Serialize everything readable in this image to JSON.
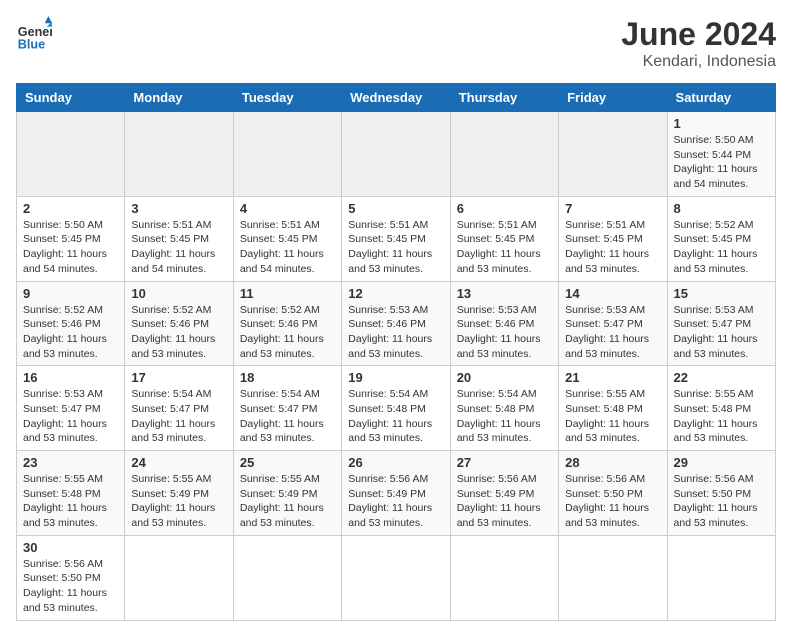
{
  "header": {
    "logo_general": "General",
    "logo_blue": "Blue",
    "title": "June 2024",
    "subtitle": "Kendari, Indonesia"
  },
  "days_of_week": [
    "Sunday",
    "Monday",
    "Tuesday",
    "Wednesday",
    "Thursday",
    "Friday",
    "Saturday"
  ],
  "weeks": [
    [
      {
        "day": "",
        "info": "",
        "empty": true
      },
      {
        "day": "",
        "info": "",
        "empty": true
      },
      {
        "day": "",
        "info": "",
        "empty": true
      },
      {
        "day": "",
        "info": "",
        "empty": true
      },
      {
        "day": "",
        "info": "",
        "empty": true
      },
      {
        "day": "",
        "info": "",
        "empty": true
      },
      {
        "day": "1",
        "info": "Sunrise: 5:50 AM\nSunset: 5:44 PM\nDaylight: 11 hours and 54 minutes."
      }
    ],
    [
      {
        "day": "2",
        "info": "Sunrise: 5:50 AM\nSunset: 5:45 PM\nDaylight: 11 hours and 54 minutes."
      },
      {
        "day": "3",
        "info": "Sunrise: 5:51 AM\nSunset: 5:45 PM\nDaylight: 11 hours and 54 minutes."
      },
      {
        "day": "4",
        "info": "Sunrise: 5:51 AM\nSunset: 5:45 PM\nDaylight: 11 hours and 54 minutes."
      },
      {
        "day": "5",
        "info": "Sunrise: 5:51 AM\nSunset: 5:45 PM\nDaylight: 11 hours and 53 minutes."
      },
      {
        "day": "6",
        "info": "Sunrise: 5:51 AM\nSunset: 5:45 PM\nDaylight: 11 hours and 53 minutes."
      },
      {
        "day": "7",
        "info": "Sunrise: 5:51 AM\nSunset: 5:45 PM\nDaylight: 11 hours and 53 minutes."
      },
      {
        "day": "8",
        "info": "Sunrise: 5:52 AM\nSunset: 5:45 PM\nDaylight: 11 hours and 53 minutes."
      }
    ],
    [
      {
        "day": "9",
        "info": "Sunrise: 5:52 AM\nSunset: 5:46 PM\nDaylight: 11 hours and 53 minutes."
      },
      {
        "day": "10",
        "info": "Sunrise: 5:52 AM\nSunset: 5:46 PM\nDaylight: 11 hours and 53 minutes."
      },
      {
        "day": "11",
        "info": "Sunrise: 5:52 AM\nSunset: 5:46 PM\nDaylight: 11 hours and 53 minutes."
      },
      {
        "day": "12",
        "info": "Sunrise: 5:53 AM\nSunset: 5:46 PM\nDaylight: 11 hours and 53 minutes."
      },
      {
        "day": "13",
        "info": "Sunrise: 5:53 AM\nSunset: 5:46 PM\nDaylight: 11 hours and 53 minutes."
      },
      {
        "day": "14",
        "info": "Sunrise: 5:53 AM\nSunset: 5:47 PM\nDaylight: 11 hours and 53 minutes."
      },
      {
        "day": "15",
        "info": "Sunrise: 5:53 AM\nSunset: 5:47 PM\nDaylight: 11 hours and 53 minutes."
      }
    ],
    [
      {
        "day": "16",
        "info": "Sunrise: 5:53 AM\nSunset: 5:47 PM\nDaylight: 11 hours and 53 minutes."
      },
      {
        "day": "17",
        "info": "Sunrise: 5:54 AM\nSunset: 5:47 PM\nDaylight: 11 hours and 53 minutes."
      },
      {
        "day": "18",
        "info": "Sunrise: 5:54 AM\nSunset: 5:47 PM\nDaylight: 11 hours and 53 minutes."
      },
      {
        "day": "19",
        "info": "Sunrise: 5:54 AM\nSunset: 5:48 PM\nDaylight: 11 hours and 53 minutes."
      },
      {
        "day": "20",
        "info": "Sunrise: 5:54 AM\nSunset: 5:48 PM\nDaylight: 11 hours and 53 minutes."
      },
      {
        "day": "21",
        "info": "Sunrise: 5:55 AM\nSunset: 5:48 PM\nDaylight: 11 hours and 53 minutes."
      },
      {
        "day": "22",
        "info": "Sunrise: 5:55 AM\nSunset: 5:48 PM\nDaylight: 11 hours and 53 minutes."
      }
    ],
    [
      {
        "day": "23",
        "info": "Sunrise: 5:55 AM\nSunset: 5:48 PM\nDaylight: 11 hours and 53 minutes."
      },
      {
        "day": "24",
        "info": "Sunrise: 5:55 AM\nSunset: 5:49 PM\nDaylight: 11 hours and 53 minutes."
      },
      {
        "day": "25",
        "info": "Sunrise: 5:55 AM\nSunset: 5:49 PM\nDaylight: 11 hours and 53 minutes."
      },
      {
        "day": "26",
        "info": "Sunrise: 5:56 AM\nSunset: 5:49 PM\nDaylight: 11 hours and 53 minutes."
      },
      {
        "day": "27",
        "info": "Sunrise: 5:56 AM\nSunset: 5:49 PM\nDaylight: 11 hours and 53 minutes."
      },
      {
        "day": "28",
        "info": "Sunrise: 5:56 AM\nSunset: 5:50 PM\nDaylight: 11 hours and 53 minutes."
      },
      {
        "day": "29",
        "info": "Sunrise: 5:56 AM\nSunset: 5:50 PM\nDaylight: 11 hours and 53 minutes."
      }
    ],
    [
      {
        "day": "30",
        "info": "Sunrise: 5:56 AM\nSunset: 5:50 PM\nDaylight: 11 hours and 53 minutes."
      },
      {
        "day": "",
        "info": "",
        "empty": true
      },
      {
        "day": "",
        "info": "",
        "empty": true
      },
      {
        "day": "",
        "info": "",
        "empty": true
      },
      {
        "day": "",
        "info": "",
        "empty": true
      },
      {
        "day": "",
        "info": "",
        "empty": true
      },
      {
        "day": "",
        "info": "",
        "empty": true
      }
    ]
  ]
}
